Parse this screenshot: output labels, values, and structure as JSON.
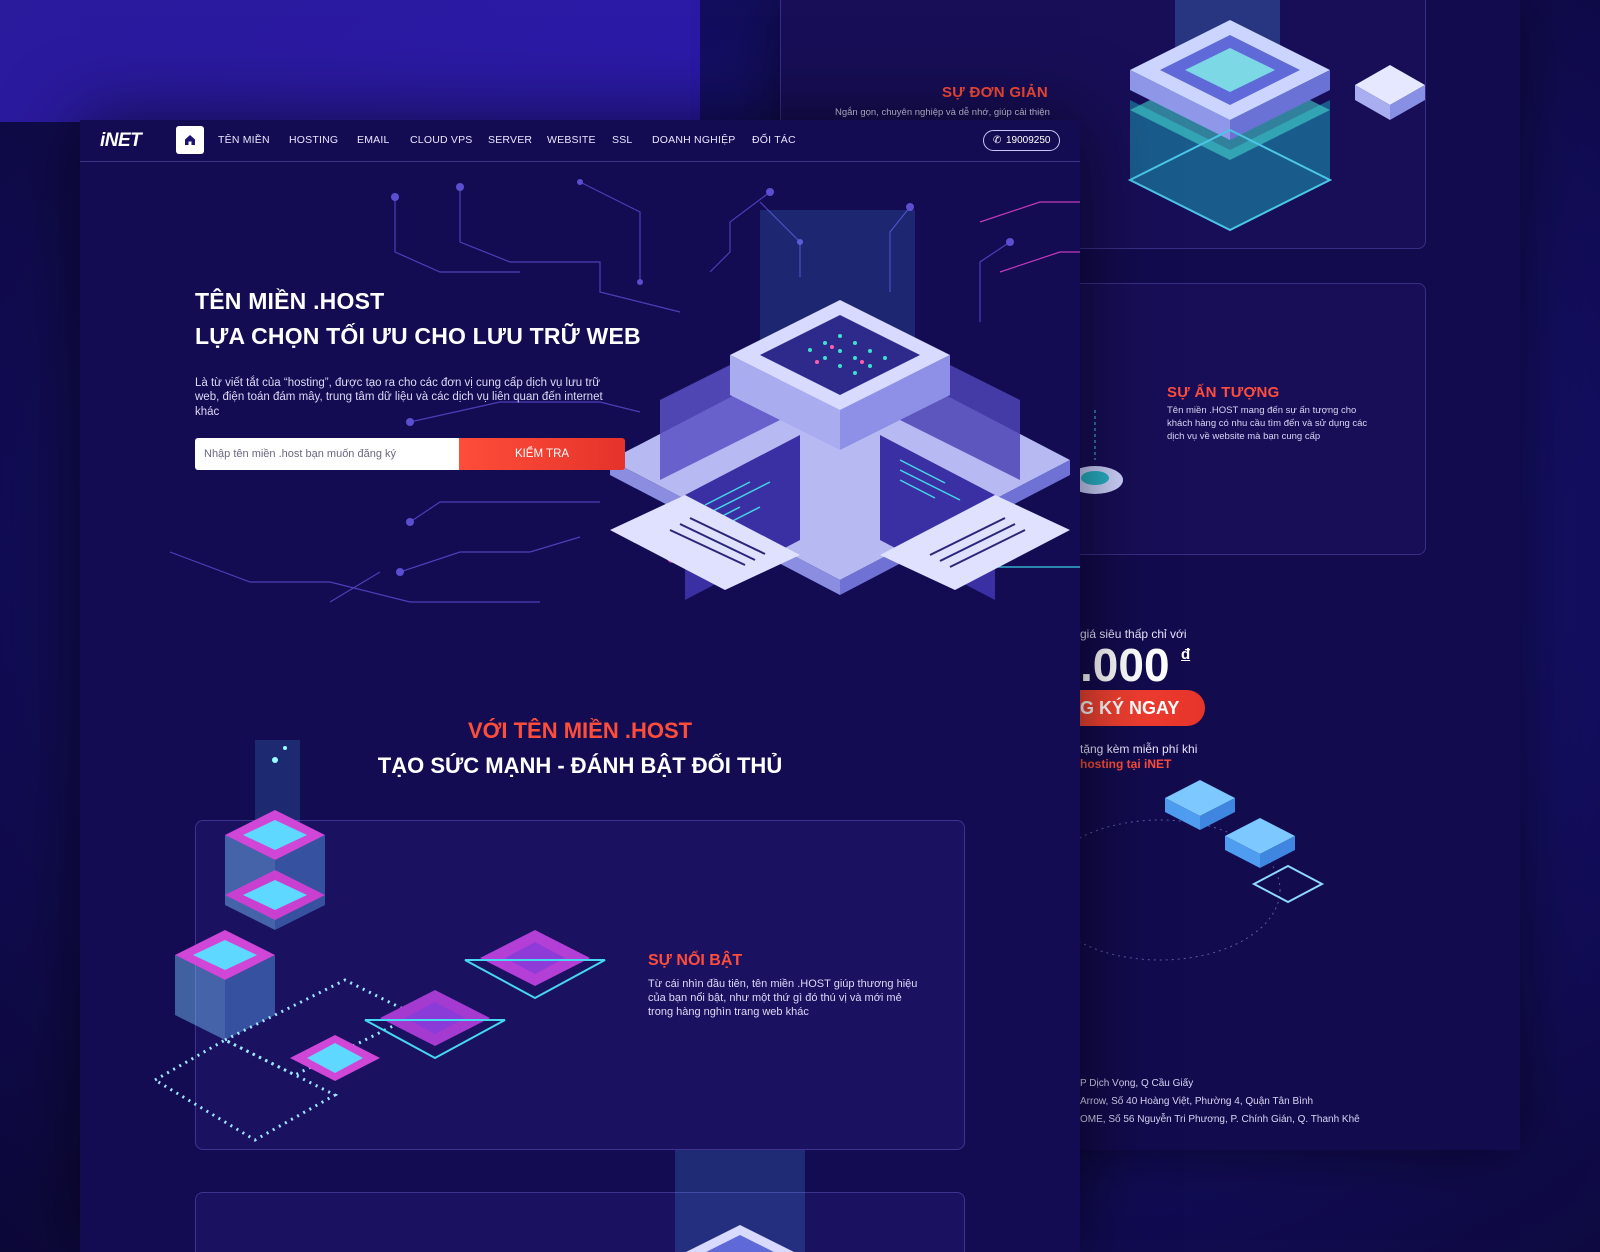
{
  "brand": {
    "logo": "iNET",
    "accent": "#ff4d3a",
    "background": "#130c52"
  },
  "nav": {
    "items": [
      "TÊN MIỀN",
      "HOSTING",
      "EMAIL",
      "CLOUD VPS",
      "SERVER",
      "WEBSITE",
      "SSL",
      "DOANH NGHIỆP",
      "ĐỐI TÁC"
    ],
    "phone": "19009250",
    "home_icon": "home-icon",
    "phone_icon": "phone-icon"
  },
  "hero": {
    "title_line1": "TÊN MIỀN .HOST",
    "title_line2": "LỰA CHỌN TỐI ƯU CHO LƯU TRỮ WEB",
    "description": "Là từ viết tắt của “hosting”, được tạo ra cho các đơn vị cung cấp dịch vụ lưu trữ web, điện toán đám mây, trung tâm dữ liệu và các dịch vụ liên quan đến internet khác",
    "search_placeholder": "Nhập tên miền .host bạn muốn đăng ký",
    "search_button": "KIỂM TRA"
  },
  "section": {
    "title_line1": "VỚI TÊN MIỀN .HOST",
    "title_line2": "TẠO SỨC MẠNH - ĐÁNH BẬT ĐỐI THỦ"
  },
  "features": {
    "standout": {
      "title": "SỰ NỔI BẬT",
      "text": "Từ cái nhìn đầu tiên, tên miền .HOST giúp thương hiệu của bạn nổi bật, như một thứ gì đó thú vị và mới mẻ trong hàng nghìn trang web khác"
    },
    "simple": {
      "title": "SỰ ĐƠN GIẢN",
      "text": "Ngắn gọn, chuyên nghiệp và dễ nhớ, giúp cải thiện"
    },
    "impressive": {
      "title": "SỰ ẤN TƯỢNG",
      "text": "Tên miền .HOST mang đến sự ấn tượng cho khách hàng có nhu cầu tìm đến và sử dụng các dịch vụ về website mà bạn cung cấp"
    }
  },
  "pricing": {
    "subtitle": "giá siêu thấp chỉ với",
    "price": ".000",
    "currency": "đ",
    "register_button": "G KÝ NGAY",
    "gift_line1": "tặng kèm miễn phí khi",
    "gift_line2": "hosting tại iNET"
  },
  "footer": {
    "addresses": [
      "P Dịch Vọng, Q Cầu Giấy",
      "Arrow, Số 40 Hoàng Việt, Phường 4, Quận Tân Bình",
      "OME, Số 56 Nguyễn Tri Phương, P. Chính Gián, Q. Thanh Khê"
    ]
  }
}
